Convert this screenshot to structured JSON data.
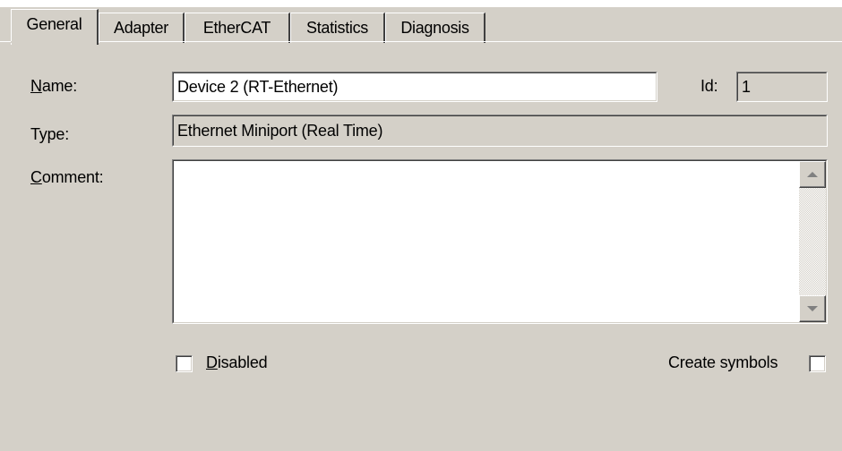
{
  "tabs": [
    {
      "label": "General",
      "active": true
    },
    {
      "label": "Adapter",
      "active": false
    },
    {
      "label": "EtherCAT",
      "active": false
    },
    {
      "label": "Statistics",
      "active": false
    },
    {
      "label": "Diagnosis",
      "active": false
    }
  ],
  "form": {
    "name_label_ul": "N",
    "name_label_rest": "ame:",
    "name_value": "Device 2 (RT-Ethernet)",
    "id_label": "Id:",
    "id_value": "1",
    "type_label": "Type:",
    "type_value": "Ethernet Miniport (Real Time)",
    "comment_label_ul": "C",
    "comment_label_rest": "omment:",
    "comment_value": "",
    "disabled_label_ul": "D",
    "disabled_label_rest": "isabled",
    "disabled_checked": false,
    "create_symbols_label": "Create symbols",
    "create_symbols_checked": false
  },
  "icons": {
    "scroll_up": "arrow-up-icon",
    "scroll_down": "arrow-down-icon"
  },
  "colors": {
    "background": "#d4d0c8",
    "field": "#ffffff"
  }
}
